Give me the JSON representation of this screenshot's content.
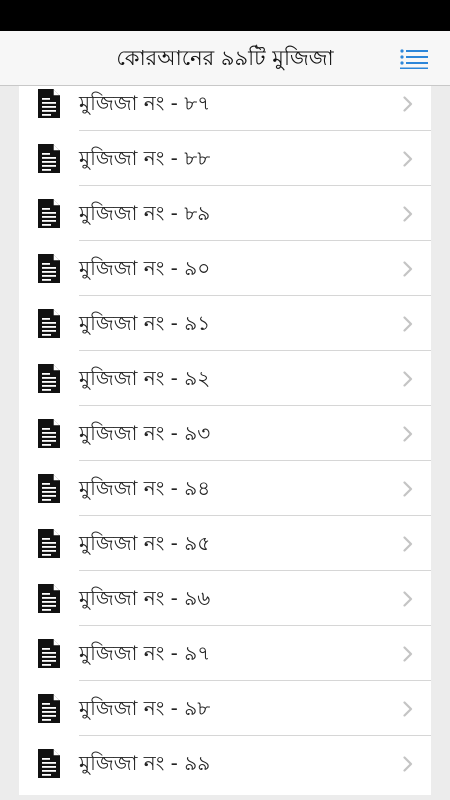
{
  "header": {
    "title": "কোরআনের ৯৯টি মুজিজা",
    "menu_icon": "list-menu-icon"
  },
  "colors": {
    "status_bar": "#000000",
    "nav_background": "#f7f7f7",
    "accent": "#2c86d9",
    "page_background": "#ececec",
    "row_background": "#ffffff",
    "chevron": "#c4c4c4"
  },
  "list": {
    "items": [
      {
        "label": "মুজিজা নং - ৮৭",
        "icon": "document-icon"
      },
      {
        "label": "মুজিজা নং - ৮৮",
        "icon": "document-icon"
      },
      {
        "label": "মুজিজা নং - ৮৯",
        "icon": "document-icon"
      },
      {
        "label": "মুজিজা নং - ৯০",
        "icon": "document-icon"
      },
      {
        "label": "মুজিজা নং - ৯১",
        "icon": "document-icon"
      },
      {
        "label": "মুজিজা নং - ৯২",
        "icon": "document-icon"
      },
      {
        "label": "মুজিজা নং - ৯৩",
        "icon": "document-icon"
      },
      {
        "label": "মুজিজা নং - ৯৪",
        "icon": "document-icon"
      },
      {
        "label": "মুজিজা নং - ৯৫",
        "icon": "document-icon"
      },
      {
        "label": "মুজিজা নং - ৯৬",
        "icon": "document-icon"
      },
      {
        "label": "মুজিজা নং - ৯৭",
        "icon": "document-icon"
      },
      {
        "label": "মুজিজা নং - ৯৮",
        "icon": "document-icon"
      },
      {
        "label": "মুজিজা নং - ৯৯",
        "icon": "document-icon"
      }
    ]
  }
}
